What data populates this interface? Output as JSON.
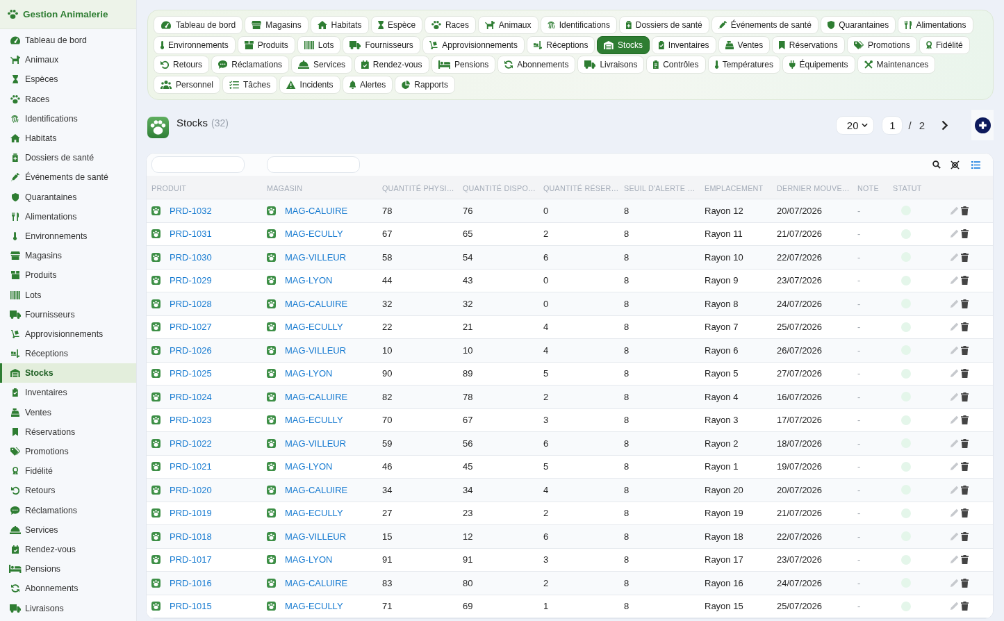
{
  "sidebar": {
    "title": "Gestion Animalerie",
    "items": [
      {
        "label": "Tableau de bord",
        "selected": false
      },
      {
        "label": "Animaux",
        "selected": false
      },
      {
        "label": "Espèces",
        "selected": false
      },
      {
        "label": "Races",
        "selected": false
      },
      {
        "label": "Identifications",
        "selected": false
      },
      {
        "label": "Habitats",
        "selected": false
      },
      {
        "label": "Dossiers de santé",
        "selected": false
      },
      {
        "label": "Événements de santé",
        "selected": false
      },
      {
        "label": "Quarantaines",
        "selected": false
      },
      {
        "label": "Alimentations",
        "selected": false
      },
      {
        "label": "Environnements",
        "selected": false
      },
      {
        "label": "Magasins",
        "selected": false
      },
      {
        "label": "Produits",
        "selected": false
      },
      {
        "label": "Lots",
        "selected": false
      },
      {
        "label": "Fournisseurs",
        "selected": false
      },
      {
        "label": "Approvisionnements",
        "selected": false
      },
      {
        "label": "Réceptions",
        "selected": false
      },
      {
        "label": "Stocks",
        "selected": true
      },
      {
        "label": "Inventaires",
        "selected": false
      },
      {
        "label": "Ventes",
        "selected": false
      },
      {
        "label": "Réservations",
        "selected": false
      },
      {
        "label": "Promotions",
        "selected": false
      },
      {
        "label": "Fidélité",
        "selected": false
      },
      {
        "label": "Retours",
        "selected": false
      },
      {
        "label": "Réclamations",
        "selected": false
      },
      {
        "label": "Services",
        "selected": false
      },
      {
        "label": "Rendez-vous",
        "selected": false
      },
      {
        "label": "Pensions",
        "selected": false
      },
      {
        "label": "Abonnements",
        "selected": false
      },
      {
        "label": "Livraisons",
        "selected": false
      }
    ]
  },
  "tab_rows": [
    {
      "tabs": [
        {
          "label": "Tableau de bord",
          "selected": false
        },
        {
          "label": "Magasins",
          "selected": false
        },
        {
          "label": "Habitats",
          "selected": false
        },
        {
          "label": "Espèce",
          "selected": false
        },
        {
          "label": "Races",
          "selected": false
        },
        {
          "label": "Animaux",
          "selected": false
        },
        {
          "label": "Identifications",
          "selected": false
        },
        {
          "label": "Dossiers de santé",
          "selected": false
        },
        {
          "label": "Événements de santé",
          "selected": false
        },
        {
          "label": "Quarantaines",
          "selected": false
        },
        {
          "label": "Alimentations",
          "selected": false
        }
      ]
    },
    {
      "tabs": [
        {
          "label": "Environnements",
          "selected": false
        },
        {
          "label": "Produits",
          "selected": false
        },
        {
          "label": "Lots",
          "selected": false
        },
        {
          "label": "Fournisseurs",
          "selected": false
        },
        {
          "label": "Approvisionnements",
          "selected": false
        },
        {
          "label": "Réceptions",
          "selected": false
        },
        {
          "label": "Stocks",
          "selected": true
        },
        {
          "label": "Inventaires",
          "selected": false
        },
        {
          "label": "Ventes",
          "selected": false
        },
        {
          "label": "Réservations",
          "selected": false
        },
        {
          "label": "Promotions",
          "selected": false
        },
        {
          "label": "Fidélité",
          "selected": false
        }
      ]
    },
    {
      "tabs": [
        {
          "label": "Retours",
          "selected": false
        },
        {
          "label": "Réclamations",
          "selected": false
        },
        {
          "label": "Services",
          "selected": false
        },
        {
          "label": "Rendez-vous",
          "selected": false
        },
        {
          "label": "Pensions",
          "selected": false
        },
        {
          "label": "Abonnements",
          "selected": false
        },
        {
          "label": "Livraisons",
          "selected": false
        },
        {
          "label": "Contrôles",
          "selected": false
        },
        {
          "label": "Températures",
          "selected": false
        },
        {
          "label": "Équipements",
          "selected": false
        },
        {
          "label": "Maintenances",
          "selected": false
        }
      ]
    },
    {
      "tabs": [
        {
          "label": "Personnel",
          "selected": false
        },
        {
          "label": "Tâches",
          "selected": false
        },
        {
          "label": "Incidents",
          "selected": false
        },
        {
          "label": "Alertes",
          "selected": false
        },
        {
          "label": "Rapports",
          "selected": false
        }
      ]
    }
  ],
  "header": {
    "title": "Stocks",
    "count": "(32)",
    "page_size": "20",
    "page": "1",
    "page_separator": "/",
    "total_pages": "2"
  },
  "table": {
    "columns": [
      {
        "label": "PRODUIT",
        "kind": "link"
      },
      {
        "label": "MAGASIN",
        "kind": "link"
      },
      {
        "label": "QUANTITÉ PHYSI…",
        "kind": "text"
      },
      {
        "label": "QUANTITÉ DISPO…",
        "kind": "text"
      },
      {
        "label": "QUANTITÉ RÉSER…",
        "kind": "text"
      },
      {
        "label": "SEUIL D'ALERTE …",
        "kind": "text"
      },
      {
        "label": "EMPLACEMENT",
        "kind": "text"
      },
      {
        "label": "DERNIER MOUVE…",
        "kind": "text"
      },
      {
        "label": "NOTE",
        "kind": "muted"
      },
      {
        "label": "STATUT",
        "kind": "status"
      }
    ],
    "rows": [
      {
        "cells": [
          "PRD-1032",
          "MAG-CALUIRE",
          "78",
          "76",
          "0",
          "8",
          "Rayon 12",
          "20/07/2026",
          "-"
        ]
      },
      {
        "cells": [
          "PRD-1031",
          "MAG-ECULLY",
          "67",
          "65",
          "2",
          "8",
          "Rayon 11",
          "21/07/2026",
          "-"
        ]
      },
      {
        "cells": [
          "PRD-1030",
          "MAG-VILLEUR",
          "58",
          "54",
          "6",
          "8",
          "Rayon 10",
          "22/07/2026",
          "-"
        ]
      },
      {
        "cells": [
          "PRD-1029",
          "MAG-LYON",
          "44",
          "43",
          "0",
          "8",
          "Rayon 9",
          "23/07/2026",
          "-"
        ]
      },
      {
        "cells": [
          "PRD-1028",
          "MAG-CALUIRE",
          "32",
          "32",
          "0",
          "8",
          "Rayon 8",
          "24/07/2026",
          "-"
        ]
      },
      {
        "cells": [
          "PRD-1027",
          "MAG-ECULLY",
          "22",
          "21",
          "4",
          "8",
          "Rayon 7",
          "25/07/2026",
          "-"
        ]
      },
      {
        "cells": [
          "PRD-1026",
          "MAG-VILLEUR",
          "10",
          "10",
          "4",
          "8",
          "Rayon 6",
          "26/07/2026",
          "-"
        ]
      },
      {
        "cells": [
          "PRD-1025",
          "MAG-LYON",
          "90",
          "89",
          "5",
          "8",
          "Rayon 5",
          "27/07/2026",
          "-"
        ]
      },
      {
        "cells": [
          "PRD-1024",
          "MAG-CALUIRE",
          "82",
          "78",
          "2",
          "8",
          "Rayon 4",
          "16/07/2026",
          "-"
        ]
      },
      {
        "cells": [
          "PRD-1023",
          "MAG-ECULLY",
          "70",
          "67",
          "3",
          "8",
          "Rayon 3",
          "17/07/2026",
          "-"
        ]
      },
      {
        "cells": [
          "PRD-1022",
          "MAG-VILLEUR",
          "59",
          "56",
          "6",
          "8",
          "Rayon 2",
          "18/07/2026",
          "-"
        ]
      },
      {
        "cells": [
          "PRD-1021",
          "MAG-LYON",
          "46",
          "45",
          "5",
          "8",
          "Rayon 1",
          "19/07/2026",
          "-"
        ]
      },
      {
        "cells": [
          "PRD-1020",
          "MAG-CALUIRE",
          "34",
          "34",
          "4",
          "8",
          "Rayon 20",
          "20/07/2026",
          "-"
        ]
      },
      {
        "cells": [
          "PRD-1019",
          "MAG-ECULLY",
          "27",
          "23",
          "2",
          "8",
          "Rayon 19",
          "21/07/2026",
          "-"
        ]
      },
      {
        "cells": [
          "PRD-1018",
          "MAG-VILLEUR",
          "15",
          "12",
          "6",
          "8",
          "Rayon 18",
          "22/07/2026",
          "-"
        ]
      },
      {
        "cells": [
          "PRD-1017",
          "MAG-LYON",
          "91",
          "91",
          "3",
          "8",
          "Rayon 17",
          "23/07/2026",
          "-"
        ]
      },
      {
        "cells": [
          "PRD-1016",
          "MAG-CALUIRE",
          "83",
          "80",
          "2",
          "8",
          "Rayon 16",
          "24/07/2026",
          "-"
        ]
      },
      {
        "cells": [
          "PRD-1015",
          "MAG-ECULLY",
          "71",
          "69",
          "1",
          "8",
          "Rayon 15",
          "25/07/2026",
          "-"
        ]
      }
    ]
  }
}
